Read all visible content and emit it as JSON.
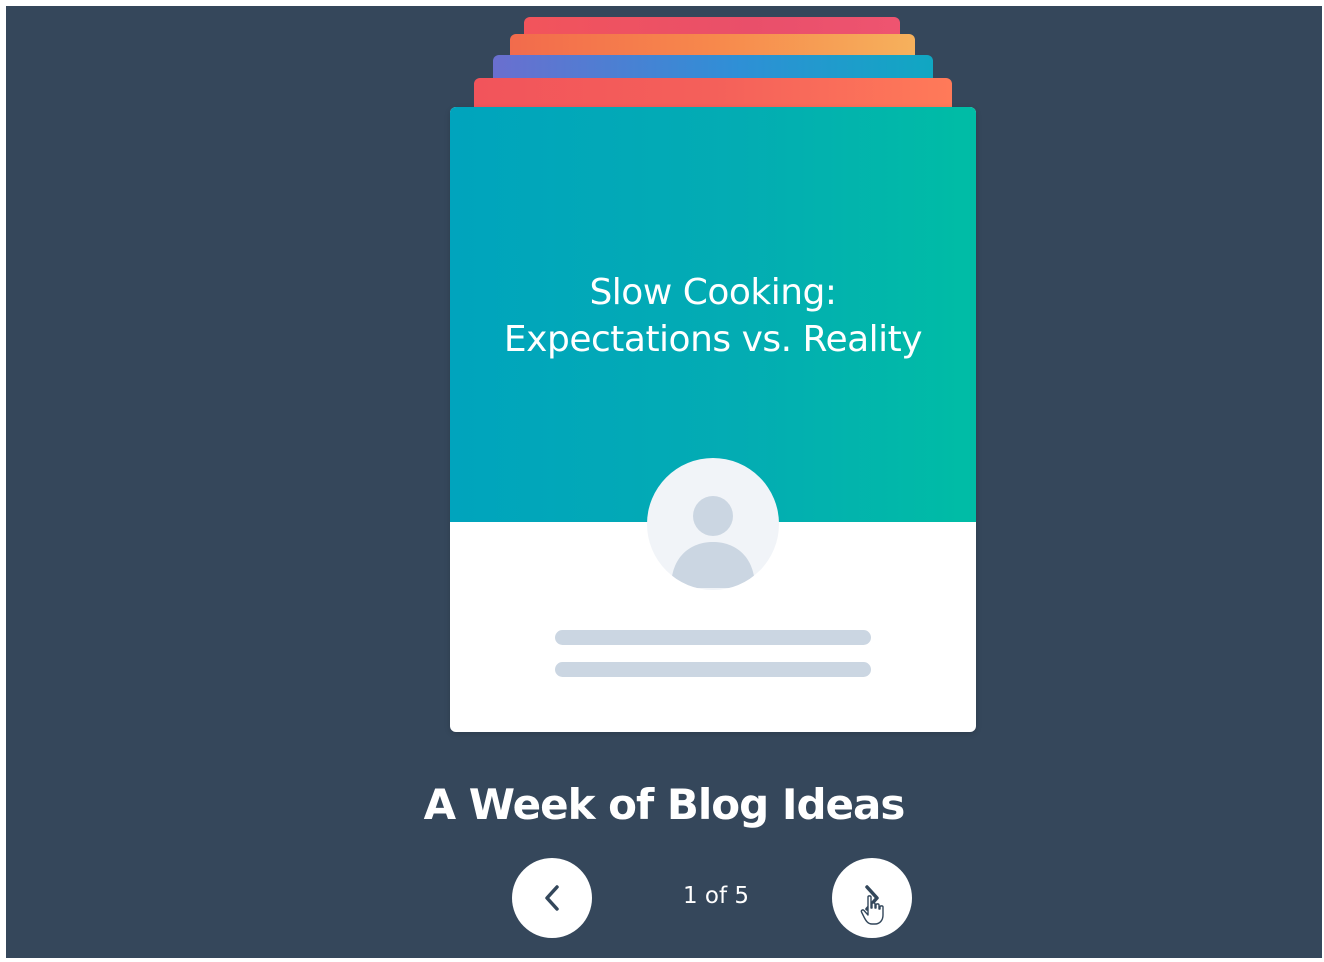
{
  "card": {
    "title_line1": "Slow Cooking:",
    "title_line2": "Expectations vs. Reality",
    "avatar_icon": "user-avatar-icon"
  },
  "carousel": {
    "heading": "A Week of Blog Ideas",
    "counter": "1 of 5",
    "current": 1,
    "total": 5,
    "prev_icon": "chevron-left-icon",
    "next_icon": "chevron-right-icon"
  },
  "colors": {
    "background": "#35475b",
    "card_teal": "#00a4bd",
    "card_green": "#00bda5",
    "stack_red": "#f2545b",
    "stack_orange": "#f7884c",
    "stack_blue": "#2f8fd6",
    "placeholder_line": "#cbd6e2"
  }
}
